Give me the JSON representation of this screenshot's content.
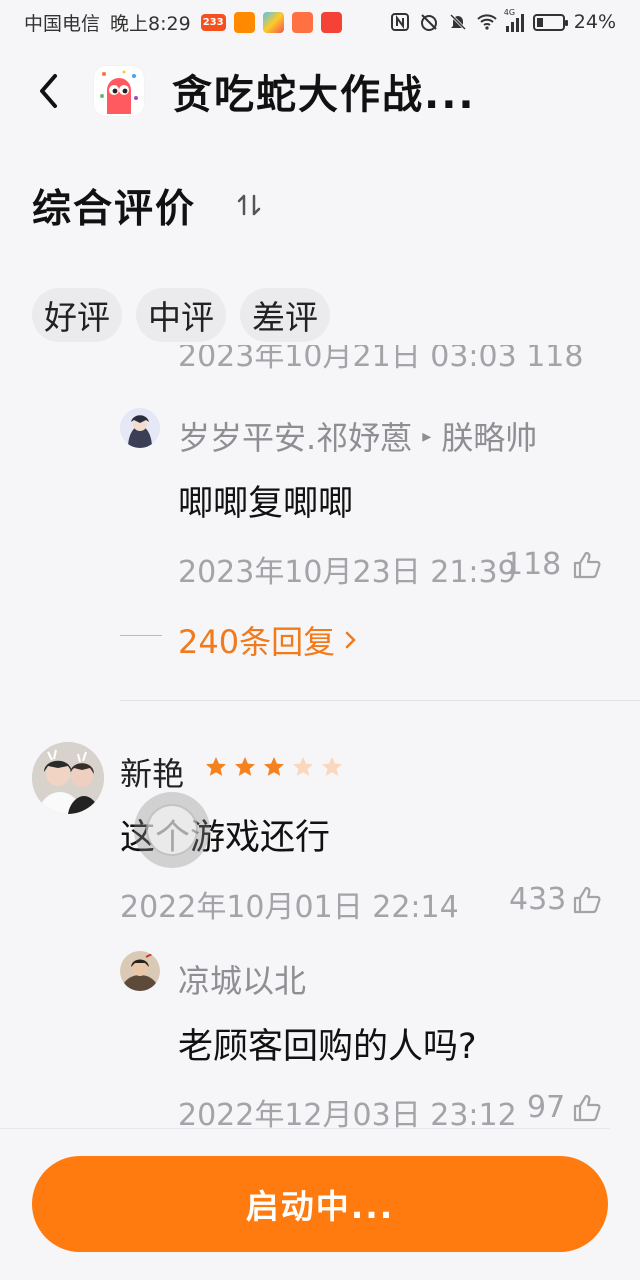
{
  "status_bar": {
    "carrier": "中国电信",
    "time": "晚上8:29",
    "badge_233": "233",
    "network": "4G",
    "battery": "24%"
  },
  "header": {
    "app_title": "贪吃蛇大作战..."
  },
  "section": {
    "title": "综合评价",
    "filters": [
      "好评",
      "中评",
      "差评"
    ]
  },
  "comments": {
    "cut_meta": "2023年10月21日 03:03 118",
    "reply1": {
      "user": "岁岁平安.祁妤蒽",
      "arrow": "▸",
      "to_user": "朕略帅",
      "text": "唧唧复唧唧",
      "date": "2023年10月23日 21:39",
      "likes": "118"
    },
    "more_replies": "240条回复",
    "review": {
      "user": "新艳",
      "rating": 3,
      "rating_max": 5,
      "text": "这个游戏还行",
      "date": "2022年10月01日 22:14",
      "likes": "433"
    },
    "reply2": {
      "user": "凉城以北",
      "text": "老顾客回购的人吗?",
      "date": "2022年12月03日 23:12",
      "likes": "97"
    }
  },
  "launch_button": "启动中...",
  "colors": {
    "accent": "#ff7a0f",
    "link": "#f07a1c",
    "star_on": "#f5821f",
    "star_off": "#fbd7bd"
  }
}
